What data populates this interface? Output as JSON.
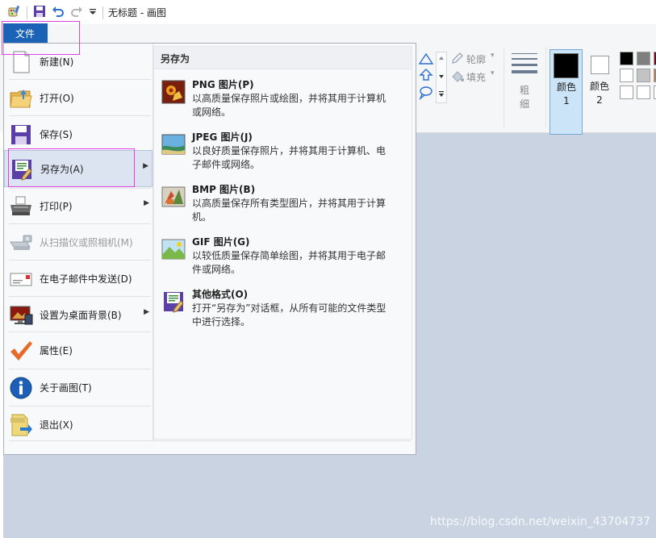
{
  "window": {
    "title": "无标题 - 画图"
  },
  "file_tab": {
    "label": "文件"
  },
  "menu_items": [
    {
      "label": "新建(N)",
      "icon": "new-file-icon",
      "has_submenu": false,
      "disabled": false
    },
    {
      "label": "打开(O)",
      "icon": "open-folder-icon",
      "has_submenu": false,
      "disabled": false
    },
    {
      "label": "保存(S)",
      "icon": "save-icon",
      "has_submenu": false,
      "disabled": false
    },
    {
      "label": "另存为(A)",
      "icon": "save-as-icon",
      "has_submenu": true,
      "disabled": false,
      "selected": true
    },
    {
      "label": "打印(P)",
      "icon": "printer-icon",
      "has_submenu": true,
      "disabled": false
    },
    {
      "label": "从扫描仪或照相机(M)",
      "icon": "scanner-icon",
      "has_submenu": false,
      "disabled": true
    },
    {
      "label": "在电子邮件中发送(D)",
      "icon": "email-icon",
      "has_submenu": false,
      "disabled": false
    },
    {
      "label": "设置为桌面背景(B)",
      "icon": "desktop-background-icon",
      "has_submenu": true,
      "disabled": false
    },
    {
      "label": "属性(E)",
      "icon": "checkmark-icon",
      "has_submenu": false,
      "disabled": false
    },
    {
      "label": "关于画图(T)",
      "icon": "info-icon",
      "has_submenu": false,
      "disabled": false
    },
    {
      "label": "退出(X)",
      "icon": "exit-icon",
      "has_submenu": false,
      "disabled": false
    }
  ],
  "save_as": {
    "header": "另存为",
    "formats": [
      {
        "title": "PNG 图片(P)",
        "desc": "以高质量保存照片或绘图，并将其用于计算机或网络。",
        "icon": "png-icon"
      },
      {
        "title": "JPEG 图片(J)",
        "desc": "以良好质量保存照片，并将其用于计算机、电子邮件或网络。",
        "icon": "jpeg-icon"
      },
      {
        "title": "BMP 图片(B)",
        "desc": "以高质量保存所有类型图片，并将其用于计算机。",
        "icon": "bmp-icon"
      },
      {
        "title": "GIF 图片(G)",
        "desc": "以较低质量保存简单绘图，并将其用于电子邮件或网络。",
        "icon": "gif-icon"
      },
      {
        "title": "其他格式(O)",
        "desc": "打开“另存为”对话框，从所有可能的文件类型中进行选择。",
        "icon": "other-formats-icon"
      }
    ]
  },
  "ribbon": {
    "outline_label": "轮廓",
    "fill_label": "填充",
    "thickness_label": "粗细",
    "color1_label": "颜色 1",
    "color2_label": "颜色 2",
    "color1": "#000000",
    "color2": "#ffffff",
    "palette": [
      "#000000",
      "#7f7f7f",
      "#ffffff",
      "#c3c3c3",
      "#ffffff",
      "#ffffff"
    ]
  },
  "watermark": "https://blog.csdn.net/weixin_43704737"
}
